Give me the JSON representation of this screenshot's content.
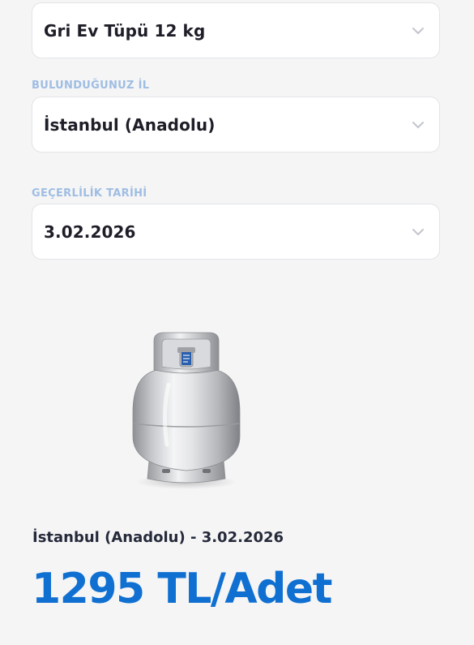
{
  "selects": {
    "product": {
      "value": "Gri Ev Tüpü 12 kg"
    },
    "province": {
      "label": "BULUNDUĞUNUZ İL",
      "value": "İstanbul (Anadolu)"
    },
    "date": {
      "label": "GEÇERLİLİK TARİHİ",
      "value": "3.02.2026"
    }
  },
  "icons": {
    "dropdown": "chevron-down-icon",
    "product_image": "gas-cylinder-image"
  },
  "result": {
    "title": "İstanbul (Anadolu) - 3.02.2026",
    "price": "1295 TL/Adet"
  },
  "colors": {
    "accent": "#1070d1",
    "label": "#9fbde2",
    "text": "#1e1e28",
    "background": "#f5f5f6"
  }
}
